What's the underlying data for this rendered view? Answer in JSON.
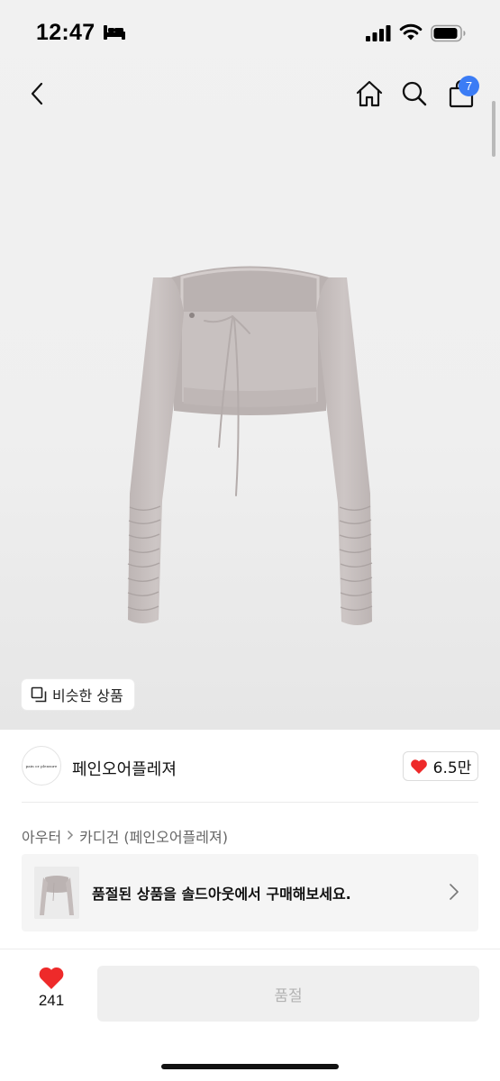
{
  "status_bar": {
    "time": "12:47"
  },
  "nav": {
    "cart_badge": "7"
  },
  "similar": {
    "label": "비슷한 상품"
  },
  "brand": {
    "name": "페인오어플레져",
    "logo_text": "pain or pleasure",
    "likes": "6.5만"
  },
  "breadcrumb": {
    "items": [
      "아우터",
      "카디건 (페인오어플레져)"
    ]
  },
  "soldout_banner": {
    "text": "품절된 상품을 솔드아웃에서 구매해보세요."
  },
  "bottom_bar": {
    "wish_count": "241",
    "action_label": "품절"
  },
  "colors": {
    "accent_red": "#ee2a2a",
    "badge_blue": "#3b7cf5",
    "garment": "#c9c1c0"
  }
}
